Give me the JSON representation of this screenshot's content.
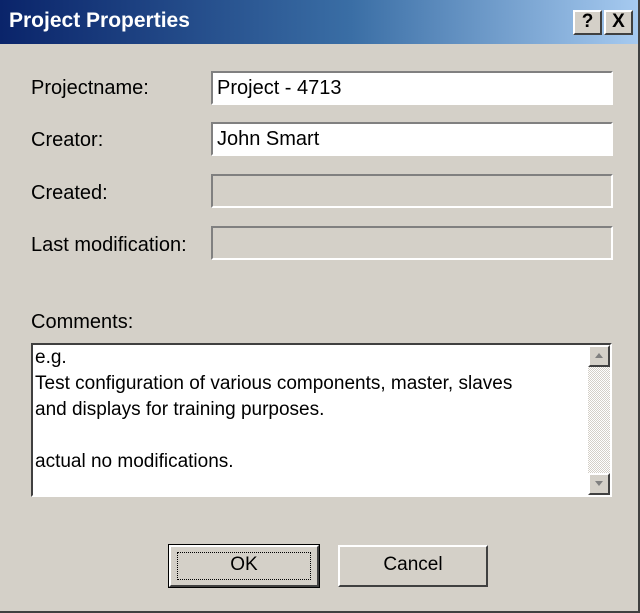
{
  "window": {
    "title": "Project Properties",
    "help_button": "?",
    "close_button": "X"
  },
  "fields": {
    "projectname": {
      "label": "Projectname:",
      "value": "Project - 4713"
    },
    "creator": {
      "label": "Creator:",
      "value": "John Smart"
    },
    "created": {
      "label": "Created:",
      "value": ""
    },
    "last_modification": {
      "label": "Last modification:",
      "value": ""
    }
  },
  "comments": {
    "label": "Comments:",
    "lines": [
      "e.g.",
      "Test configuration of various components, master, slaves",
      "and displays for training purposes.",
      "",
      "actual no modifications."
    ]
  },
  "buttons": {
    "ok": "OK",
    "cancel": "Cancel"
  },
  "icons": {
    "scroll_up": "arrow-up-icon",
    "scroll_down": "arrow-down-icon"
  },
  "colors": {
    "title_gradient_start": "#0a246a",
    "title_gradient_end": "#a6caf0",
    "dialog_face": "#d4d0c8"
  }
}
